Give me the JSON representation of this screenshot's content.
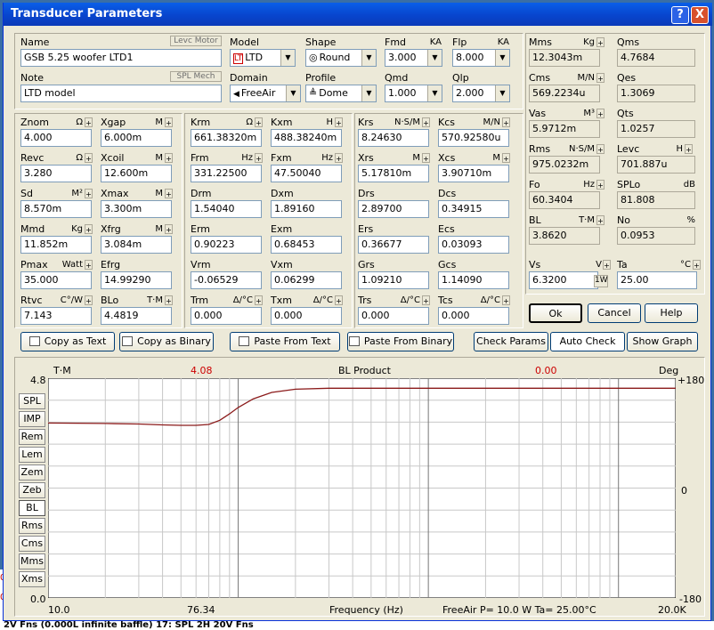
{
  "window": {
    "title": "Transducer Parameters",
    "help_label": "?",
    "close_label": "X"
  },
  "header": {
    "name_label": "Name",
    "name_value": "GSB 5.25 woofer LTD1",
    "levc_motor_label": "Levc Motor",
    "note_label": "Note",
    "note_value": "LTD model",
    "spl_mech_label": "SPL Mech",
    "model_label": "Model",
    "model_value": "LTD",
    "domain_label": "Domain",
    "domain_value": "FreeAir",
    "shape_label": "Shape",
    "shape_value": "Round",
    "profile_label": "Profile",
    "profile_value": "Dome",
    "fmd_label": "Fmd",
    "fmd_unit": "KA",
    "fmd_value": "3.000",
    "flp_label": "Flp",
    "flp_unit": "KA",
    "flp_value": "8.000",
    "qmd_label": "Qmd",
    "qmd_value": "1.000",
    "qlp_label": "Qlp",
    "qlp_value": "2.000"
  },
  "left_params": [
    {
      "label": "Znom",
      "unit": "Ω",
      "value": "4.000"
    },
    {
      "label": "Xgap",
      "unit": "M",
      "value": "6.000m"
    },
    {
      "label": "Revc",
      "unit": "Ω",
      "value": "3.280"
    },
    {
      "label": "Xcoil",
      "unit": "M",
      "value": "12.600m"
    },
    {
      "label": "Sd",
      "unit": "M²",
      "value": "8.570m"
    },
    {
      "label": "Xmax",
      "unit": "M",
      "value": "3.300m"
    },
    {
      "label": "Mmd",
      "unit": "Kg",
      "value": "11.852m"
    },
    {
      "label": "Xfrg",
      "unit": "M",
      "value": "3.084m"
    },
    {
      "label": "Pmax",
      "unit": "Watt",
      "value": "35.000"
    },
    {
      "label": "Efrg",
      "unit": "",
      "value": "14.99290"
    },
    {
      "label": "Rtvc",
      "unit": "C°/W",
      "value": "7.143"
    },
    {
      "label": "BLo",
      "unit": "T·M",
      "value": "4.4819"
    }
  ],
  "mid_params": [
    {
      "label": "Krm",
      "unit": "Ω",
      "value": "661.38320m"
    },
    {
      "label": "Kxm",
      "unit": "H",
      "value": "488.38240m"
    },
    {
      "label": "Frm",
      "unit": "Hz",
      "value": "331.22500"
    },
    {
      "label": "Fxm",
      "unit": "Hz",
      "value": "47.50040"
    },
    {
      "label": "Drm",
      "unit": "",
      "value": "1.54040"
    },
    {
      "label": "Dxm",
      "unit": "",
      "value": "1.89160"
    },
    {
      "label": "Erm",
      "unit": "",
      "value": "0.90223"
    },
    {
      "label": "Exm",
      "unit": "",
      "value": "0.68453"
    },
    {
      "label": "Vrm",
      "unit": "",
      "value": "-0.06529"
    },
    {
      "label": "Vxm",
      "unit": "",
      "value": "0.06299"
    },
    {
      "label": "Trm",
      "unit": "Δ/°C",
      "value": "0.000"
    },
    {
      "label": "Txm",
      "unit": "Δ/°C",
      "value": "0.000"
    }
  ],
  "right_params": [
    {
      "label": "Krs",
      "unit": "N·S/M",
      "value": "8.24630"
    },
    {
      "label": "Kcs",
      "unit": "M/N",
      "value": "570.92580u"
    },
    {
      "label": "Xrs",
      "unit": "M",
      "value": "5.17810m"
    },
    {
      "label": "Xcs",
      "unit": "M",
      "value": "3.90710m"
    },
    {
      "label": "Drs",
      "unit": "",
      "value": "2.89700"
    },
    {
      "label": "Dcs",
      "unit": "",
      "value": "0.34915"
    },
    {
      "label": "Ers",
      "unit": "",
      "value": "0.36677"
    },
    {
      "label": "Ecs",
      "unit": "",
      "value": "0.03093"
    },
    {
      "label": "Grs",
      "unit": "",
      "value": "1.09210"
    },
    {
      "label": "Gcs",
      "unit": "",
      "value": "1.14090"
    },
    {
      "label": "Trs",
      "unit": "Δ/°C",
      "value": "0.000"
    },
    {
      "label": "Tcs",
      "unit": "Δ/°C",
      "value": "0.000"
    }
  ],
  "readouts": [
    {
      "label": "Mms",
      "unit": "Kg",
      "value": "12.3043m"
    },
    {
      "label": "Qms",
      "unit": "",
      "value": "4.7684"
    },
    {
      "label": "Cms",
      "unit": "M/N",
      "value": "569.2234u"
    },
    {
      "label": "Qes",
      "unit": "",
      "value": "1.3069"
    },
    {
      "label": "Vas",
      "unit": "M³",
      "value": "5.9712m"
    },
    {
      "label": "Qts",
      "unit": "",
      "value": "1.0257"
    },
    {
      "label": "Rms",
      "unit": "N·S/M",
      "value": "975.0232m"
    },
    {
      "label": "Levc",
      "unit": "H",
      "value": "701.887u"
    },
    {
      "label": "Fo",
      "unit": "Hz",
      "value": "60.3404"
    },
    {
      "label": "SPLo",
      "unit": "dB",
      "value": "81.808"
    },
    {
      "label": "BL",
      "unit": "T·M",
      "value": "3.8620"
    },
    {
      "label": "No",
      "unit": "%",
      "value": "0.0953"
    }
  ],
  "vs": {
    "label": "Vs",
    "unit": "V",
    "value": "6.3200",
    "btn": "1W"
  },
  "ta": {
    "label": "Ta",
    "unit": "°C",
    "value": "25.00"
  },
  "buttons": {
    "ok": "Ok",
    "cancel": "Cancel",
    "help": "Help",
    "copy_text": "Copy as Text",
    "copy_binary": "Copy as Binary",
    "paste_text": "Paste From Text",
    "paste_binary": "Paste From Binary",
    "check_params": "Check Params",
    "auto_check": "Auto Check",
    "show_graph": "Show Graph"
  },
  "graph_tabs": [
    "SPL",
    "IMP",
    "Rem",
    "Lem",
    "Zem",
    "Zeb",
    "BL",
    "Rms",
    "Cms",
    "Mms",
    "Xms"
  ],
  "graph": {
    "left_unit": "T·M",
    "right_unit": "Deg",
    "left_top": "4.8",
    "left_bottom": "0.0",
    "right_top": "+180",
    "right_mid": "0",
    "right_bottom": "-180",
    "cursor_left": "4.08",
    "cursor_right": "0.00",
    "title": "BL Product",
    "x_start": "10.0",
    "x_cursor": "76.34",
    "x_end": "20.0K",
    "xlabel": "Frequency (Hz)",
    "status": "FreeAir  P= 10.0 W  Ta= 25.00°C"
  },
  "chart_data": {
    "type": "line",
    "title": "BL Product",
    "xlabel": "Frequency (Hz)",
    "ylabel": "T·M",
    "xscale": "log",
    "xlim": [
      10,
      20000
    ],
    "ylim": [
      0,
      4.8
    ],
    "series": [
      {
        "x": [
          10,
          20,
          30,
          40,
          50,
          60,
          70,
          80,
          90,
          100,
          120,
          150,
          200,
          300,
          500,
          1000,
          5000,
          20000
        ],
        "y": [
          3.82,
          3.81,
          3.8,
          3.78,
          3.77,
          3.77,
          3.79,
          3.88,
          4.02,
          4.16,
          4.35,
          4.49,
          4.56,
          4.58,
          4.58,
          4.58,
          4.58,
          4.58
        ]
      }
    ],
    "color": "#8b1a1a"
  },
  "desktop": {
    "strip_text": "2V Fns (0.000L  infinite baffle)          17: SPL 2H 20V Fns"
  }
}
